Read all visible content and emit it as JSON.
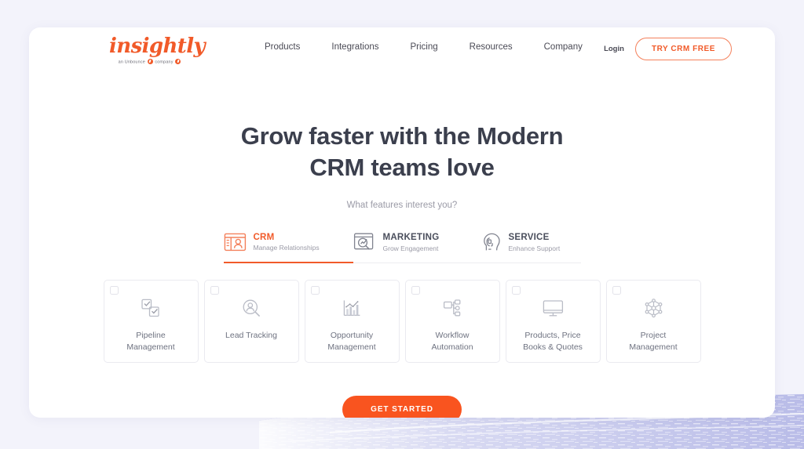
{
  "brand": {
    "wordmark": "insightly",
    "tagline_before": "an Unbounce",
    "tagline_after": "company",
    "accent_color": "#f15a29"
  },
  "nav": {
    "items": [
      {
        "label": "Products"
      },
      {
        "label": "Integrations"
      },
      {
        "label": "Pricing"
      },
      {
        "label": "Resources"
      },
      {
        "label": "Company"
      }
    ],
    "login_label": "Login",
    "trial_label": "TRY CRM FREE"
  },
  "hero": {
    "headline_line1": "Grow faster with the Modern",
    "headline_line2": "CRM teams love",
    "subtitle": "What features interest you?"
  },
  "tabs": [
    {
      "id": "crm",
      "title": "CRM",
      "subtitle": "Manage Relationships",
      "icon": "contact-card-icon",
      "active": true
    },
    {
      "id": "marketing",
      "title": "MARKETING",
      "subtitle": "Grow Engagement",
      "icon": "chart-search-icon",
      "active": false
    },
    {
      "id": "service",
      "title": "SERVICE",
      "subtitle": "Enhance Support",
      "icon": "headset-profile-icon",
      "active": false
    }
  ],
  "features": [
    {
      "label_line1": "Pipeline",
      "label_line2": "Management",
      "icon": "checklist-icon",
      "checked": false
    },
    {
      "label_line1": "Lead Tracking",
      "label_line2": "",
      "icon": "person-search-icon",
      "checked": false
    },
    {
      "label_line1": "Opportunity",
      "label_line2": "Management",
      "icon": "bar-chart-icon",
      "checked": false
    },
    {
      "label_line1": "Workflow",
      "label_line2": "Automation",
      "icon": "flow-nodes-icon",
      "checked": false
    },
    {
      "label_line1": "Products, Price",
      "label_line2": "Books & Quotes",
      "icon": "monitor-icon",
      "checked": false
    },
    {
      "label_line1": "Project",
      "label_line2": "Management",
      "icon": "network-atom-icon",
      "checked": false
    }
  ],
  "cta": {
    "label": "GET STARTED",
    "color": "#f9541f"
  },
  "theme": {
    "page_background": "#f3f3fb",
    "card_background": "#ffffff",
    "brush_color": "#b9bce8"
  }
}
